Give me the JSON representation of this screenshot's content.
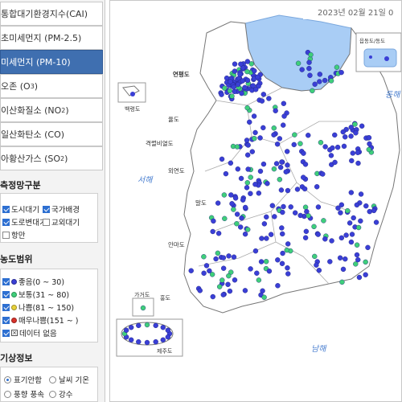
{
  "menu": {
    "items": [
      {
        "label": "통합대기환경지수(CAI)"
      },
      {
        "label": "초미세먼지 (PM-2.5)"
      },
      {
        "label": "미세먼지 (PM-10)"
      },
      {
        "label": "오존 (O",
        "sub": "3",
        "tail": ")"
      },
      {
        "label": "이산화질소 (NO",
        "sub": "2",
        "tail": ")"
      },
      {
        "label": "일산화탄소 (CO)"
      },
      {
        "label": "아황산가스 (SO",
        "sub": "2",
        "tail": ")"
      }
    ],
    "active_index": 2
  },
  "network": {
    "title": "측정망구분",
    "options": [
      {
        "label": "도시대기",
        "checked": true
      },
      {
        "label": "국가배경",
        "checked": true
      },
      {
        "label": "도로변대기",
        "checked": true
      },
      {
        "label": "교외대기",
        "checked": false
      },
      {
        "label": "항만",
        "checked": false
      }
    ]
  },
  "range": {
    "title": "농도범위",
    "levels": [
      {
        "label": "좋음(0 ~ 30)",
        "color": "#3a3fd6",
        "checked": true
      },
      {
        "label": "보통(31 ~ 80)",
        "color": "#3fcf7a",
        "checked": true
      },
      {
        "label": "나쁨(81 ~ 150)",
        "color": "#e8d23a",
        "checked": true
      },
      {
        "label": "매우나쁨(151 ~ )",
        "color": "#d8322a",
        "checked": true
      },
      {
        "label": "데이터 없음",
        "color": "#ffffff",
        "checked": true
      }
    ]
  },
  "weather": {
    "title": "기상정보",
    "options": [
      {
        "label": "표기안함",
        "selected": true
      },
      {
        "label": "날씨 기온",
        "selected": false
      },
      {
        "label": "풍향 풍속",
        "selected": false
      },
      {
        "label": "강수",
        "selected": false
      }
    ]
  },
  "map": {
    "date_label": "2023년 02월 21일 0",
    "legend_label": "읍동도/동도",
    "colors": {
      "good": "#3a3fd6",
      "normal": "#3fcf7a",
      "no_data": "#ffffff",
      "sea_blue_region": "#a9cdf5",
      "land": "#ffffff",
      "sea": "#ffffff"
    },
    "place_labels": {
      "yeonpyeong": "연평도",
      "baengnyeong": "백령도",
      "yeongdo": "율도",
      "gyeokryeol": "격렬비열도",
      "oeyeon": "외연도",
      "malldo": "말도",
      "anmado": "안마도",
      "gageodo": "가거도",
      "hongdo": "홍도",
      "jeju": "제주도",
      "seohae": "서해",
      "donghae": "동해",
      "namhae": "남해"
    }
  }
}
